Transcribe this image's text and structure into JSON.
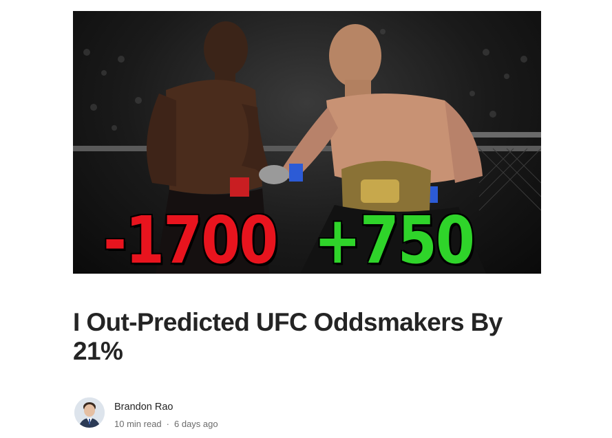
{
  "hero": {
    "odds_left": "-1700",
    "odds_right": "+750",
    "odds_left_color": "#e8141e",
    "odds_right_color": "#2fd42a"
  },
  "article": {
    "title": "I Out-Predicted UFC Oddsmakers By 21%"
  },
  "author": {
    "name": "Brandon Rao",
    "read_time": "10 min read",
    "separator": "·",
    "published": "6 days ago"
  }
}
